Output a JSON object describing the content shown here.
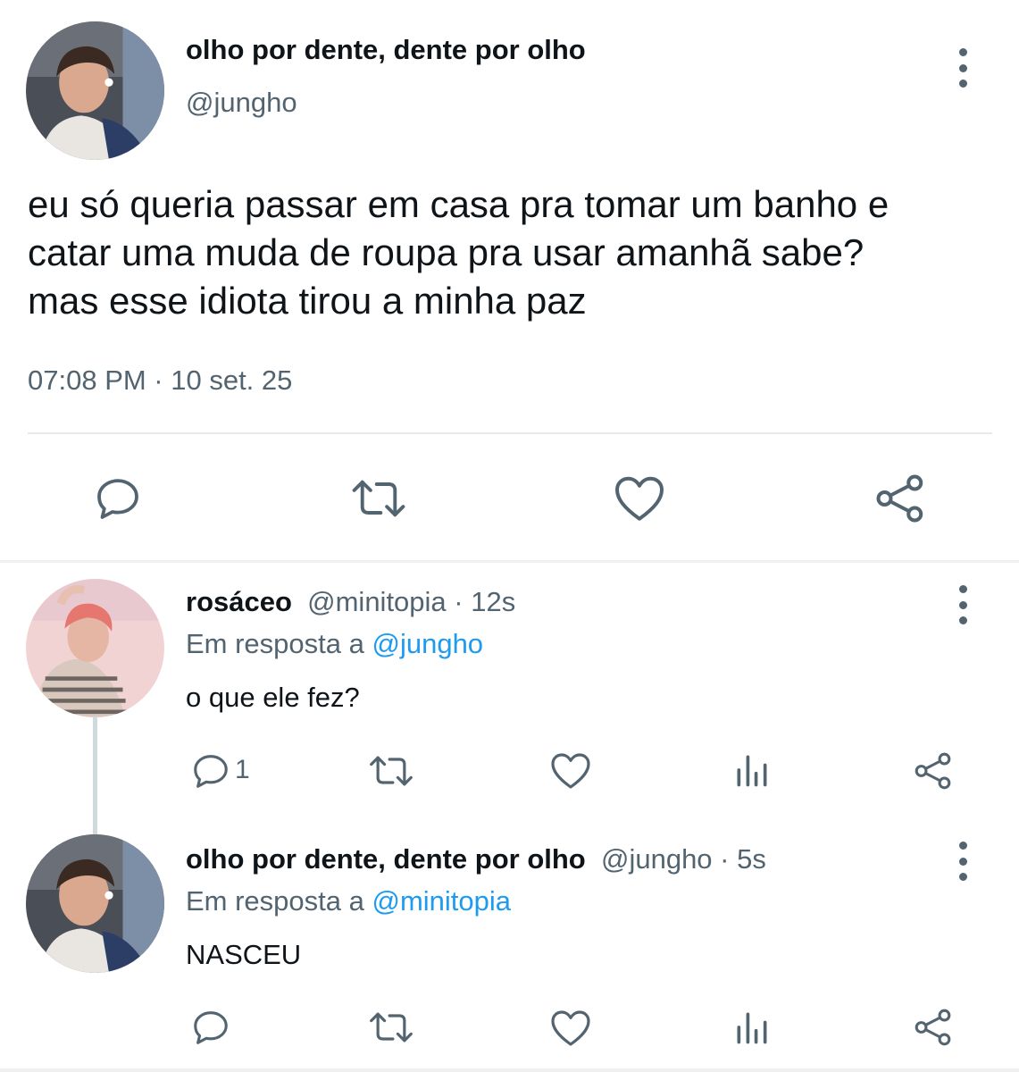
{
  "main_tweet": {
    "display_name": "olho por dente, dente por olho",
    "handle": "@jungho",
    "text_lines": [
      "eu só queria passar em casa pra tomar um banho e",
      "catar uma muda de roupa pra usar amanhã sabe?",
      "mas esse idiota tirou a minha paz"
    ],
    "timestamp": "07:08 PM · 10 set. 25",
    "actions": [
      "reply-icon",
      "retweet-icon",
      "like-icon",
      "share-icon"
    ]
  },
  "replies": [
    {
      "display_name": "rosáceo",
      "handle": "@minitopia",
      "time": " · 12s",
      "reply_label": "Em resposta a ",
      "reply_to": "@jungho",
      "text": "o que ele fez?",
      "reply_count": "1",
      "actions": [
        "reply-icon",
        "retweet-icon",
        "like-icon",
        "views-icon",
        "share-icon"
      ]
    },
    {
      "display_name": "olho por dente, dente por olho",
      "handle": "@jungho",
      "time": " · 5s",
      "reply_label": "Em resposta a ",
      "reply_to": "@minitopia",
      "text": "NASCEU",
      "reply_count": "",
      "actions": [
        "reply-icon",
        "retweet-icon",
        "like-icon",
        "views-icon",
        "share-icon"
      ]
    }
  ],
  "colors": {
    "text_primary": "#0f1419",
    "text_secondary": "#536471",
    "link": "#1d9bf0",
    "divider": "#e6e9eb"
  }
}
